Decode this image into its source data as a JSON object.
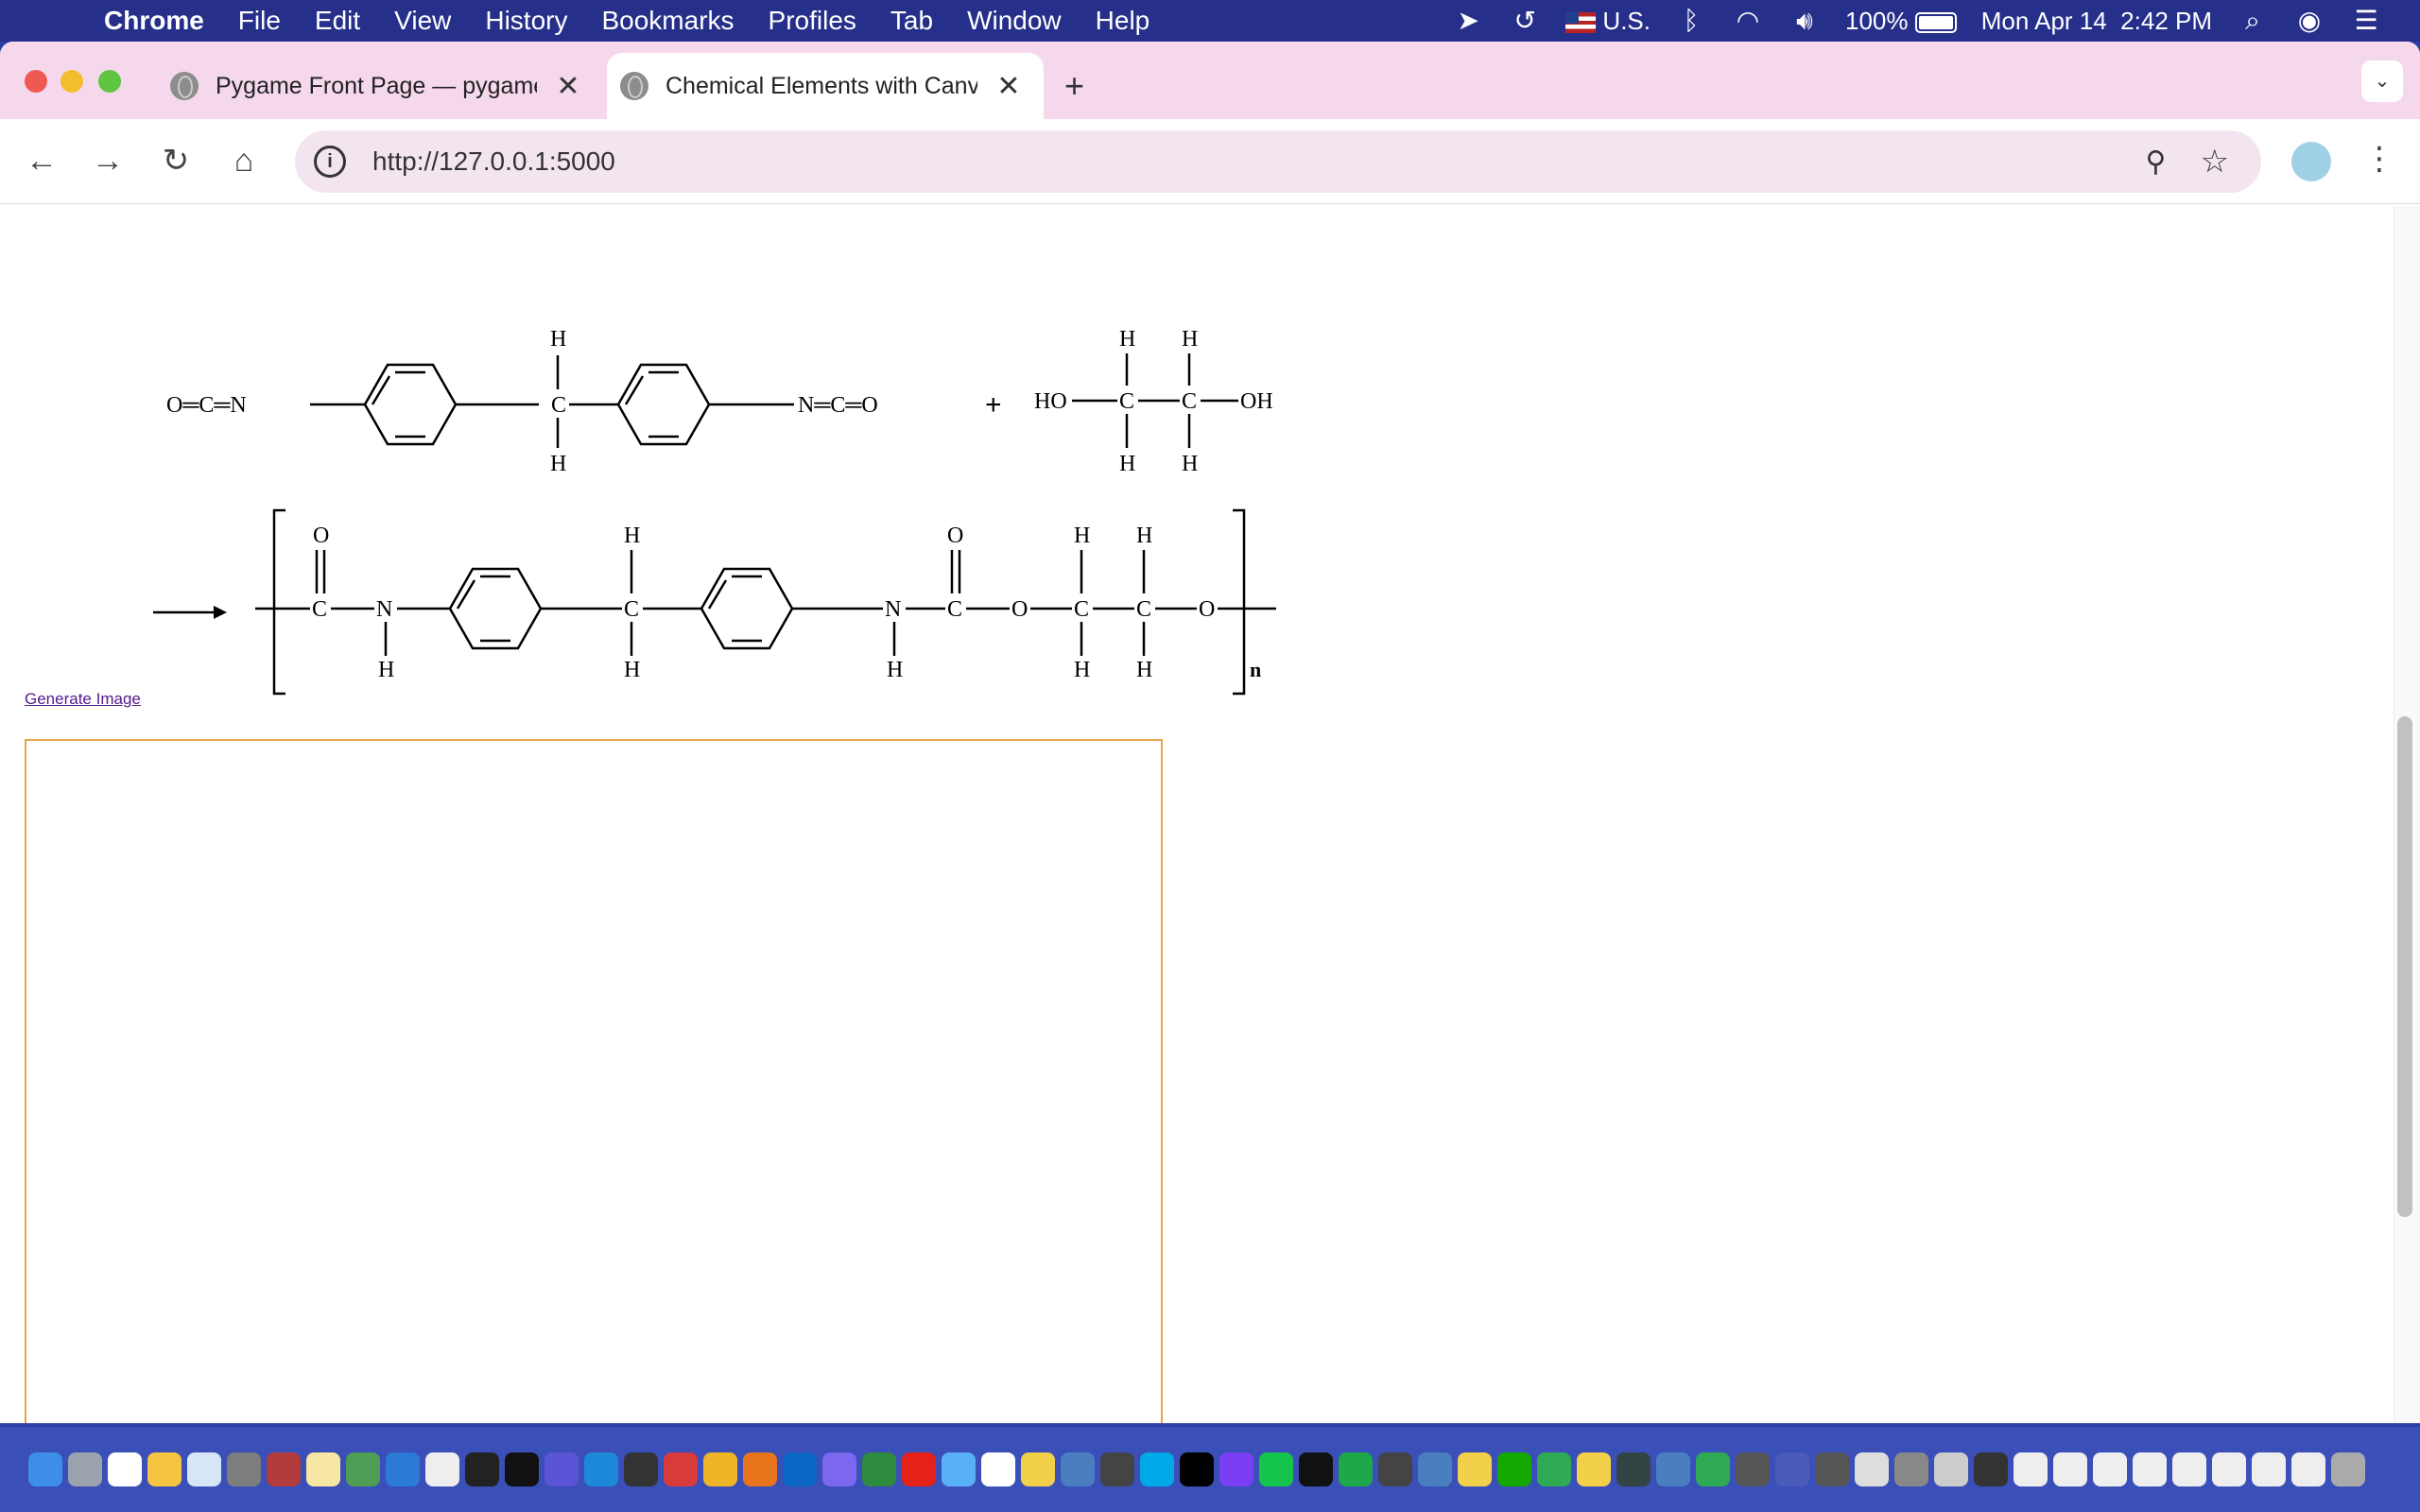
{
  "menubar": {
    "app_name": "Chrome",
    "items": [
      "File",
      "Edit",
      "View",
      "History",
      "Bookmarks",
      "Profiles",
      "Tab",
      "Window",
      "Help"
    ],
    "input_source": "U.S.",
    "battery": "100%",
    "date": "Mon Apr 14",
    "time": "2:42 PM"
  },
  "tabs": [
    {
      "title": "Pygame Front Page — pygame"
    },
    {
      "title": "Chemical Elements with Canvas"
    }
  ],
  "address_bar": {
    "url": "http://127.0.0.1:5000"
  },
  "page": {
    "generate_link": "Generate Image"
  },
  "reaction": {
    "mdi": {
      "left_group": "O═C═N",
      "right_group": "N═C═O",
      "central_carbon": "C",
      "hydrogen": "H"
    },
    "plus": "+",
    "glycol": {
      "left": "HO",
      "right": "OH",
      "carbon": "C",
      "hydrogen": "H"
    },
    "polymer": {
      "oxygen": "O",
      "carbon": "C",
      "nitrogen": "N",
      "hydrogen": "H",
      "subscript": "n"
    }
  },
  "colors": {
    "menubar_bg": "#26308a",
    "tabstrip_bg": "#f5d8ec",
    "omnibox_bg": "#f3e5ef",
    "canvas_border": "#e8a44a",
    "link": "#551a8b"
  }
}
